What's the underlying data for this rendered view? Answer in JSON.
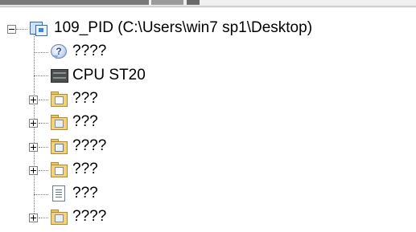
{
  "tree": {
    "root": {
      "label": "109_PID (C:\\Users\\win7 sp1\\Desktop)",
      "icon": "project-icon",
      "expanded": true
    },
    "items": [
      {
        "label": "????",
        "icon": "help-icon",
        "expandable": false
      },
      {
        "label": "CPU ST20",
        "icon": "cpu-icon",
        "expandable": false
      },
      {
        "label": "???",
        "icon": "folder-icon",
        "expandable": true
      },
      {
        "label": "???",
        "icon": "folder-icon",
        "expandable": true
      },
      {
        "label": "????",
        "icon": "folder-icon",
        "expandable": true
      },
      {
        "label": "???",
        "icon": "folder-icon",
        "expandable": true
      },
      {
        "label": "???",
        "icon": "document-icon",
        "expandable": false
      },
      {
        "label": "????",
        "icon": "folder-icon",
        "expandable": true
      }
    ]
  }
}
